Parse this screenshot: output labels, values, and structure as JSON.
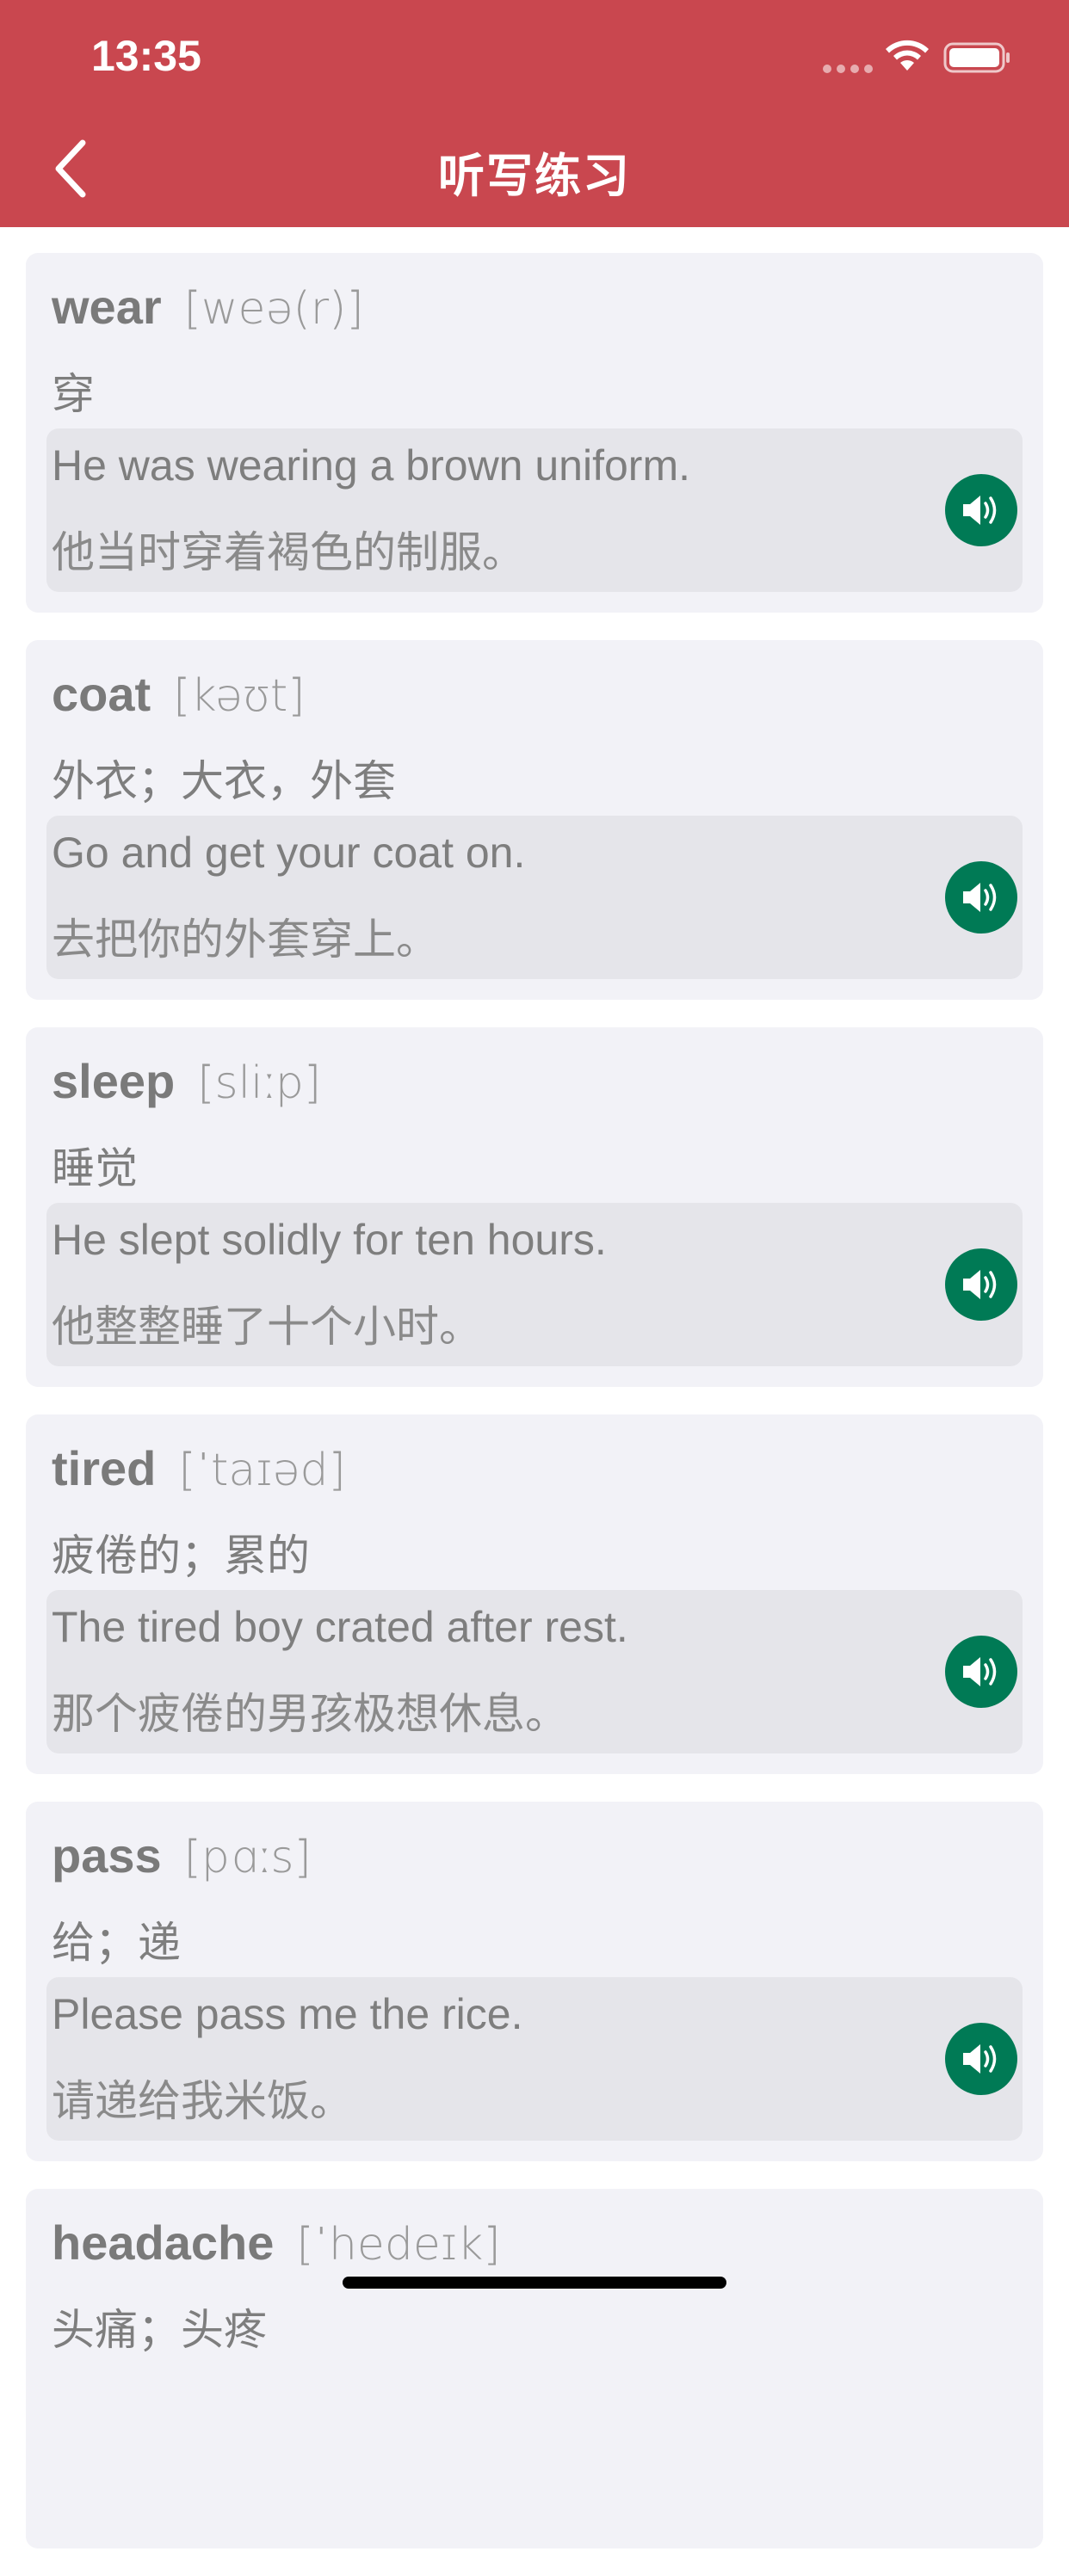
{
  "status_bar": {
    "time": "13:35"
  },
  "nav": {
    "title": "听写练习",
    "back_icon": "chevron-left-icon"
  },
  "colors": {
    "header_bg": "#C9474F",
    "card_bg": "#F2F2F7",
    "example_bg": "#E5E5EA",
    "speaker_bg": "#007A55"
  },
  "words": [
    {
      "word": "wear",
      "phonetic": "[weə(r)]",
      "meaning": "穿",
      "example_en": "He was wearing a brown uniform.",
      "example_zh": "他当时穿着褐色的制服。"
    },
    {
      "word": "coat",
      "phonetic": "[kəʊt]",
      "meaning": "外衣；大衣，外套",
      "example_en": "Go and get your coat on.",
      "example_zh": "去把你的外套穿上。"
    },
    {
      "word": "sleep",
      "phonetic": "[sliːp]",
      "meaning": "睡觉",
      "example_en": "He slept solidly for ten hours.",
      "example_zh": "他整整睡了十个小时。"
    },
    {
      "word": "tired",
      "phonetic": "[ˈtaɪəd]",
      "meaning": "疲倦的；累的",
      "example_en": "The tired boy crated after rest.",
      "example_zh": "那个疲倦的男孩极想休息。"
    },
    {
      "word": "pass",
      "phonetic": "[pɑːs]",
      "meaning": "给；递",
      "example_en": "Please pass me the rice.",
      "example_zh": "请递给我米饭。"
    },
    {
      "word": "headache",
      "phonetic": "[ˈhedeɪk]",
      "meaning": "头痛；头疼",
      "example_en": "",
      "example_zh": ""
    }
  ]
}
